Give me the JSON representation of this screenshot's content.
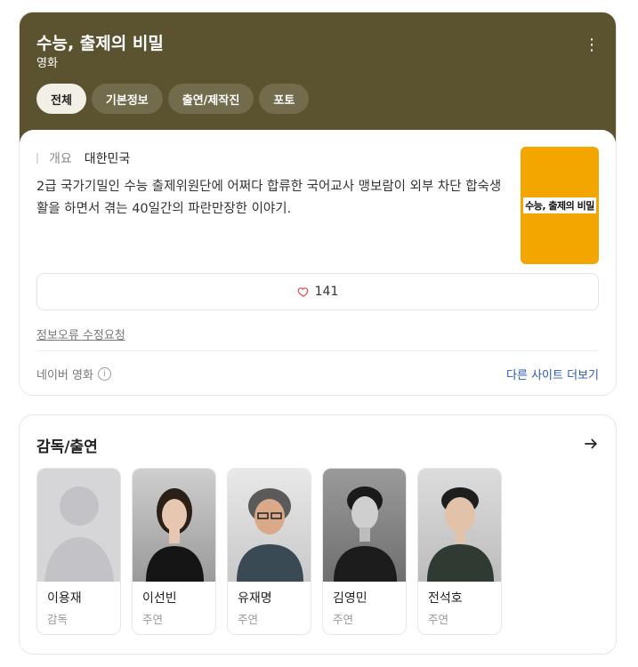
{
  "header": {
    "title": "수능, 출제의 비밀",
    "subtitle": "영화",
    "more_icon": "kebab-menu-icon"
  },
  "tabs": [
    {
      "label": "전체",
      "active": true
    },
    {
      "label": "기본정보",
      "active": false
    },
    {
      "label": "출연/제작진",
      "active": false
    },
    {
      "label": "포토",
      "active": false
    }
  ],
  "overview": {
    "label": "개요",
    "country": "대한민국",
    "synopsis": "2급 국가기밀인 수능 출제위원단에 어쩌다 합류한 국어교사 맹보람이 외부 차단 합숙생활을 하면서 겪는 40일간의 파란만장한 이야기.",
    "poster_text": "수능, 출제의 비밀",
    "poster_color": "#f3a600"
  },
  "likes": {
    "count": "141",
    "icon": "heart-icon"
  },
  "report_link": "정보오류 수정요청",
  "source": {
    "label": "네이버 영화",
    "more_sites": "다른 사이트 더보기"
  },
  "cast_section": {
    "title": "감독/출연",
    "people": [
      {
        "name": "이용재",
        "role": "감독",
        "placeholder": true
      },
      {
        "name": "이선빈",
        "role": "주연",
        "placeholder": false
      },
      {
        "name": "유재명",
        "role": "주연",
        "placeholder": false
      },
      {
        "name": "김영민",
        "role": "주연",
        "placeholder": false
      },
      {
        "name": "전석호",
        "role": "주연",
        "placeholder": false
      }
    ]
  },
  "colors": {
    "header_bg": "#5b532f",
    "link": "#2a5bb5",
    "heart": "#e5484d"
  }
}
